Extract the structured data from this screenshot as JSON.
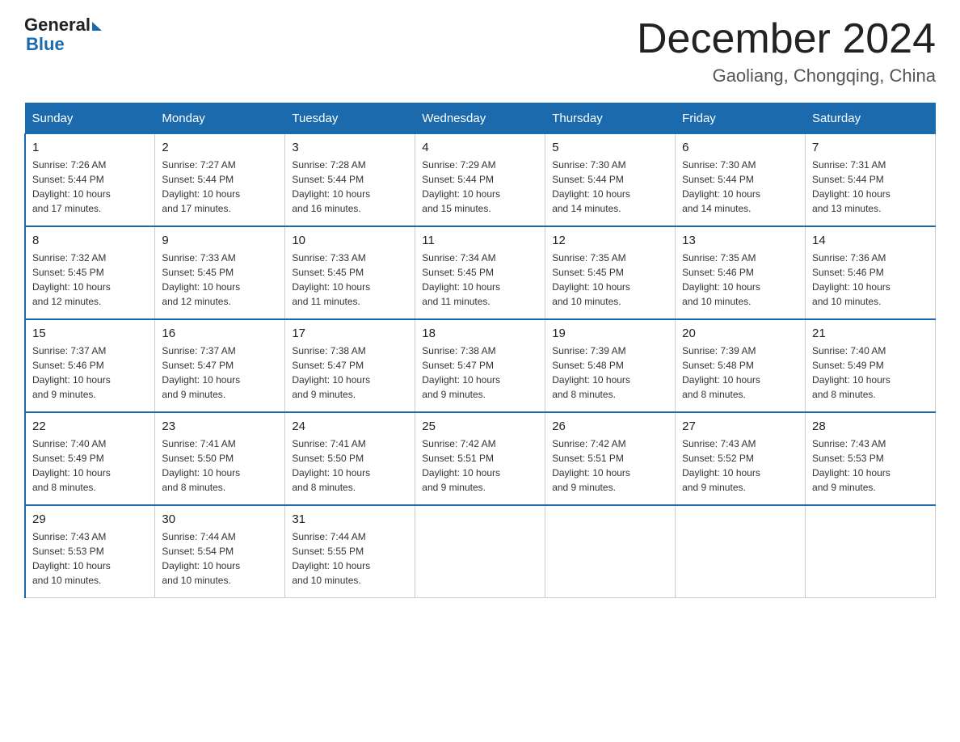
{
  "header": {
    "logo_general": "General",
    "logo_blue": "Blue",
    "month": "December 2024",
    "location": "Gaoliang, Chongqing, China"
  },
  "weekdays": [
    "Sunday",
    "Monday",
    "Tuesday",
    "Wednesday",
    "Thursday",
    "Friday",
    "Saturday"
  ],
  "weeks": [
    [
      {
        "day": "1",
        "sunrise": "7:26 AM",
        "sunset": "5:44 PM",
        "daylight": "10 hours and 17 minutes."
      },
      {
        "day": "2",
        "sunrise": "7:27 AM",
        "sunset": "5:44 PM",
        "daylight": "10 hours and 17 minutes."
      },
      {
        "day": "3",
        "sunrise": "7:28 AM",
        "sunset": "5:44 PM",
        "daylight": "10 hours and 16 minutes."
      },
      {
        "day": "4",
        "sunrise": "7:29 AM",
        "sunset": "5:44 PM",
        "daylight": "10 hours and 15 minutes."
      },
      {
        "day": "5",
        "sunrise": "7:30 AM",
        "sunset": "5:44 PM",
        "daylight": "10 hours and 14 minutes."
      },
      {
        "day": "6",
        "sunrise": "7:30 AM",
        "sunset": "5:44 PM",
        "daylight": "10 hours and 14 minutes."
      },
      {
        "day": "7",
        "sunrise": "7:31 AM",
        "sunset": "5:44 PM",
        "daylight": "10 hours and 13 minutes."
      }
    ],
    [
      {
        "day": "8",
        "sunrise": "7:32 AM",
        "sunset": "5:45 PM",
        "daylight": "10 hours and 12 minutes."
      },
      {
        "day": "9",
        "sunrise": "7:33 AM",
        "sunset": "5:45 PM",
        "daylight": "10 hours and 12 minutes."
      },
      {
        "day": "10",
        "sunrise": "7:33 AM",
        "sunset": "5:45 PM",
        "daylight": "10 hours and 11 minutes."
      },
      {
        "day": "11",
        "sunrise": "7:34 AM",
        "sunset": "5:45 PM",
        "daylight": "10 hours and 11 minutes."
      },
      {
        "day": "12",
        "sunrise": "7:35 AM",
        "sunset": "5:45 PM",
        "daylight": "10 hours and 10 minutes."
      },
      {
        "day": "13",
        "sunrise": "7:35 AM",
        "sunset": "5:46 PM",
        "daylight": "10 hours and 10 minutes."
      },
      {
        "day": "14",
        "sunrise": "7:36 AM",
        "sunset": "5:46 PM",
        "daylight": "10 hours and 10 minutes."
      }
    ],
    [
      {
        "day": "15",
        "sunrise": "7:37 AM",
        "sunset": "5:46 PM",
        "daylight": "10 hours and 9 minutes."
      },
      {
        "day": "16",
        "sunrise": "7:37 AM",
        "sunset": "5:47 PM",
        "daylight": "10 hours and 9 minutes."
      },
      {
        "day": "17",
        "sunrise": "7:38 AM",
        "sunset": "5:47 PM",
        "daylight": "10 hours and 9 minutes."
      },
      {
        "day": "18",
        "sunrise": "7:38 AM",
        "sunset": "5:47 PM",
        "daylight": "10 hours and 9 minutes."
      },
      {
        "day": "19",
        "sunrise": "7:39 AM",
        "sunset": "5:48 PM",
        "daylight": "10 hours and 8 minutes."
      },
      {
        "day": "20",
        "sunrise": "7:39 AM",
        "sunset": "5:48 PM",
        "daylight": "10 hours and 8 minutes."
      },
      {
        "day": "21",
        "sunrise": "7:40 AM",
        "sunset": "5:49 PM",
        "daylight": "10 hours and 8 minutes."
      }
    ],
    [
      {
        "day": "22",
        "sunrise": "7:40 AM",
        "sunset": "5:49 PM",
        "daylight": "10 hours and 8 minutes."
      },
      {
        "day": "23",
        "sunrise": "7:41 AM",
        "sunset": "5:50 PM",
        "daylight": "10 hours and 8 minutes."
      },
      {
        "day": "24",
        "sunrise": "7:41 AM",
        "sunset": "5:50 PM",
        "daylight": "10 hours and 8 minutes."
      },
      {
        "day": "25",
        "sunrise": "7:42 AM",
        "sunset": "5:51 PM",
        "daylight": "10 hours and 9 minutes."
      },
      {
        "day": "26",
        "sunrise": "7:42 AM",
        "sunset": "5:51 PM",
        "daylight": "10 hours and 9 minutes."
      },
      {
        "day": "27",
        "sunrise": "7:43 AM",
        "sunset": "5:52 PM",
        "daylight": "10 hours and 9 minutes."
      },
      {
        "day": "28",
        "sunrise": "7:43 AM",
        "sunset": "5:53 PM",
        "daylight": "10 hours and 9 minutes."
      }
    ],
    [
      {
        "day": "29",
        "sunrise": "7:43 AM",
        "sunset": "5:53 PM",
        "daylight": "10 hours and 10 minutes."
      },
      {
        "day": "30",
        "sunrise": "7:44 AM",
        "sunset": "5:54 PM",
        "daylight": "10 hours and 10 minutes."
      },
      {
        "day": "31",
        "sunrise": "7:44 AM",
        "sunset": "5:55 PM",
        "daylight": "10 hours and 10 minutes."
      },
      null,
      null,
      null,
      null
    ]
  ],
  "labels": {
    "sunrise": "Sunrise:",
    "sunset": "Sunset:",
    "daylight": "Daylight:"
  }
}
